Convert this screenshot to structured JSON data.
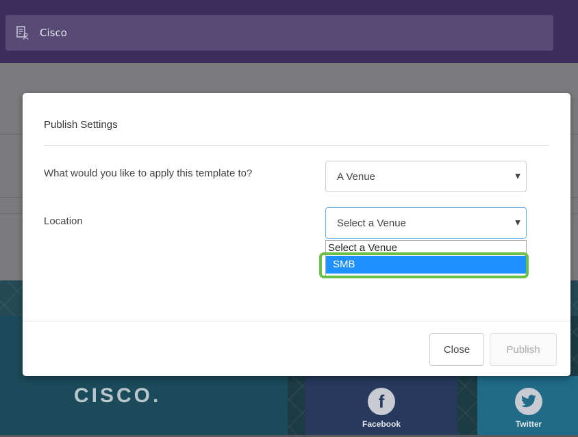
{
  "app": {
    "title": "Cisco",
    "title_icon": "directory-user-icon"
  },
  "banner": {
    "logo_text": "CISCO.",
    "facebook_label": "Facebook",
    "facebook_icon": "facebook-icon",
    "twitter_label": "Twitter",
    "twitter_icon": "twitter-icon"
  },
  "modal": {
    "title": "Publish Settings",
    "apply_label": "What would you like to apply this template to?",
    "apply_value": "A Venue",
    "location_label": "Location",
    "location_value": "Select a Venue",
    "dropdown_options": [
      {
        "label": "Select a Venue",
        "selected": false
      },
      {
        "label": "SMB",
        "selected": true
      }
    ],
    "close_label": "Close",
    "publish_label": "Publish",
    "highlight_color": "#6cc04a",
    "selection_color": "#1e90ff"
  }
}
